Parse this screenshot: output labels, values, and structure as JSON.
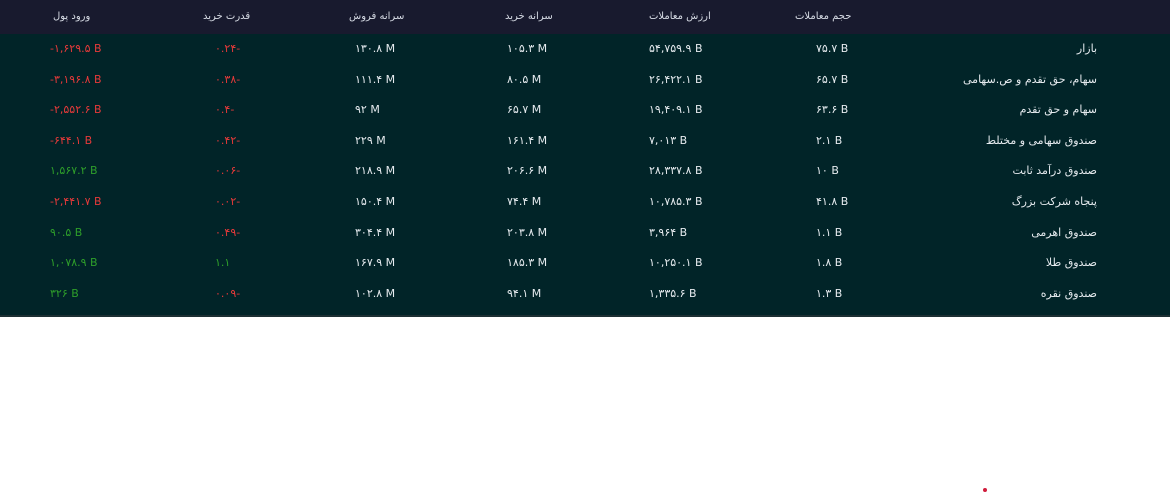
{
  "table": {
    "headers": {
      "volume": "حجم معاملات",
      "value": "ارزش معاملات",
      "per_capita_buy": "سرانه خرید",
      "per_capita_sell": "سرانه فروش",
      "buy_power": "قدرت خرید",
      "money_flow": "ورود پول"
    },
    "rows": [
      {
        "name": "بازار",
        "volume": "۷۵.۷ B",
        "value": "۵۴,۷۵۹.۹ B",
        "buy": "۱۰۵.۳ M",
        "sell": "۱۳۰.۸ M",
        "power": "۰.۲۴-",
        "flow": "-۱,۶۲۹.۵ B",
        "power_sign": "neg",
        "flow_sign": "neg"
      },
      {
        "name": "سهام، حق تقدم و ص.سهامی",
        "volume": "۶۵.۷ B",
        "value": "۲۶,۴۲۲.۱ B",
        "buy": "۸۰.۵ M",
        "sell": "۱۱۱.۴ M",
        "power": "۰.۳۸-",
        "flow": "-۳,۱۹۶.۸ B",
        "power_sign": "neg",
        "flow_sign": "neg"
      },
      {
        "name": "سهام و حق تقدم",
        "volume": "۶۳.۶ B",
        "value": "۱۹,۴۰۹.۱ B",
        "buy": "۶۵.۷ M",
        "sell": "۹۲ M",
        "power": "۰.۴-",
        "flow": "-۲,۵۵۲.۶ B",
        "power_sign": "neg",
        "flow_sign": "neg"
      },
      {
        "name": "صندوق سهامی و مختلط",
        "volume": "۲.۱ B",
        "value": "۷,۰۱۳ B",
        "buy": "۱۶۱.۴ M",
        "sell": "۲۲۹ M",
        "power": "۰.۴۲-",
        "flow": "-۶۴۴.۱ B",
        "power_sign": "neg",
        "flow_sign": "neg"
      },
      {
        "name": "صندوق درآمد ثابت",
        "volume": "۱۰ B",
        "value": "۲۸,۳۳۷.۸ B",
        "buy": "۲۰۶.۶ M",
        "sell": "۲۱۸.۹ M",
        "power": "۰.۰۶-",
        "flow": "۱,۵۶۷.۲ B",
        "power_sign": "neg",
        "flow_sign": "pos"
      },
      {
        "name": "پنجاه شرکت بزرگ",
        "volume": "۴۱.۸ B",
        "value": "۱۰,۷۸۵.۳ B",
        "buy": "۷۴.۴ M",
        "sell": "۱۵۰.۴ M",
        "power": "۰.۰۲-",
        "flow": "-۲,۴۴۱.۷ B",
        "power_sign": "neg",
        "flow_sign": "neg"
      },
      {
        "name": "صندوق اهرمی",
        "volume": "۱.۱ B",
        "value": "۳,۹۶۴ B",
        "buy": "۲۰۳.۸ M",
        "sell": "۳۰۴.۴ M",
        "power": "۰.۴۹-",
        "flow": "۹۰.۵ B",
        "power_sign": "neg",
        "flow_sign": "pos"
      },
      {
        "name": "صندوق طلا",
        "volume": "۱.۸ B",
        "value": "۱۰,۲۵۰.۱ B",
        "buy": "۱۸۵.۳ M",
        "sell": "۱۶۷.۹ M",
        "power": "۱.۱",
        "flow": "۱,۰۷۸.۹ B",
        "power_sign": "pos",
        "flow_sign": "pos"
      },
      {
        "name": "صندوق نقره",
        "volume": "۱.۳ B",
        "value": "۱,۳۳۵.۶ B",
        "buy": "۹۴.۱ M",
        "sell": "۱۰۲.۸ M",
        "power": "۰.۰۹-",
        "flow": "۳۲۶ B",
        "power_sign": "neg",
        "flow_sign": "pos"
      }
    ]
  },
  "colors": {
    "background": "#012428",
    "header": "#181a2e",
    "negative": "#e63a3a",
    "positive": "#2e9e2a"
  }
}
